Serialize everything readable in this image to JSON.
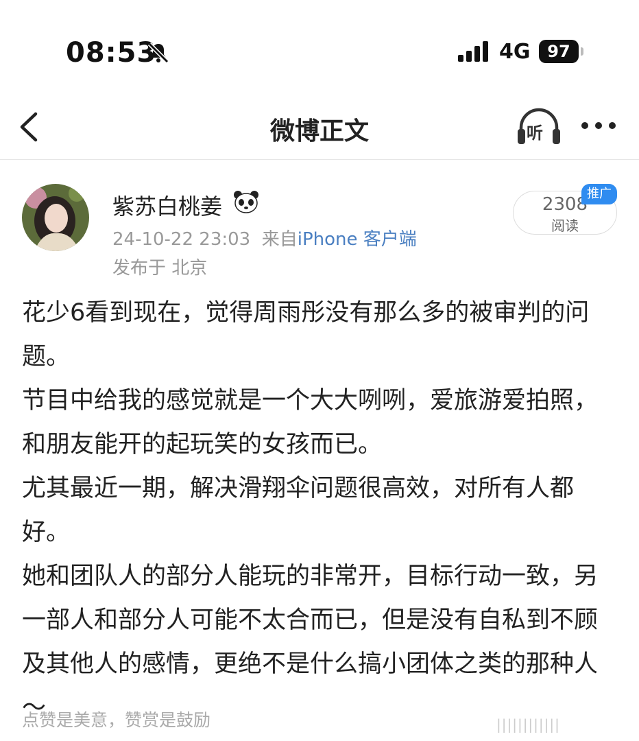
{
  "status_bar": {
    "time": "08:53",
    "network": "4G",
    "battery": "97"
  },
  "nav": {
    "title": "微博正文",
    "listen_label": "听"
  },
  "author": {
    "name": "紫苏白桃姜",
    "badge_icon": "panda-icon",
    "timestamp": "24-10-22 23:03",
    "source_prefix": "来自",
    "source_client": "iPhone 客户端",
    "location": "发布于 北京"
  },
  "reads": {
    "count": "2308",
    "label": "阅读",
    "promo_badge": "推广"
  },
  "post": {
    "paragraphs": [
      "花少6看到现在，觉得周雨彤没有那么多的被审判的问题。",
      "节目中给我的感觉就是一个大大咧咧，爱旅游爱拍照，和朋友能开的起玩笑的女孩而已。",
      "尤其最近一期，解决滑翔伞问题很高效，对所有人都好。",
      "她和团队人的部分人能玩的非常开，目标行动一致，另一部人和部分人可能不太合而已，但是没有自私到不顾及其他人的感情，更绝不是什么搞小团体之类的那种人～"
    ]
  },
  "footer": {
    "note": "点赞是美意，赞赏是鼓励",
    "watermark": "||||||||||||"
  },
  "colors": {
    "link": "#4a7fc1",
    "promo": "#2f8cf0",
    "muted": "#999999"
  }
}
